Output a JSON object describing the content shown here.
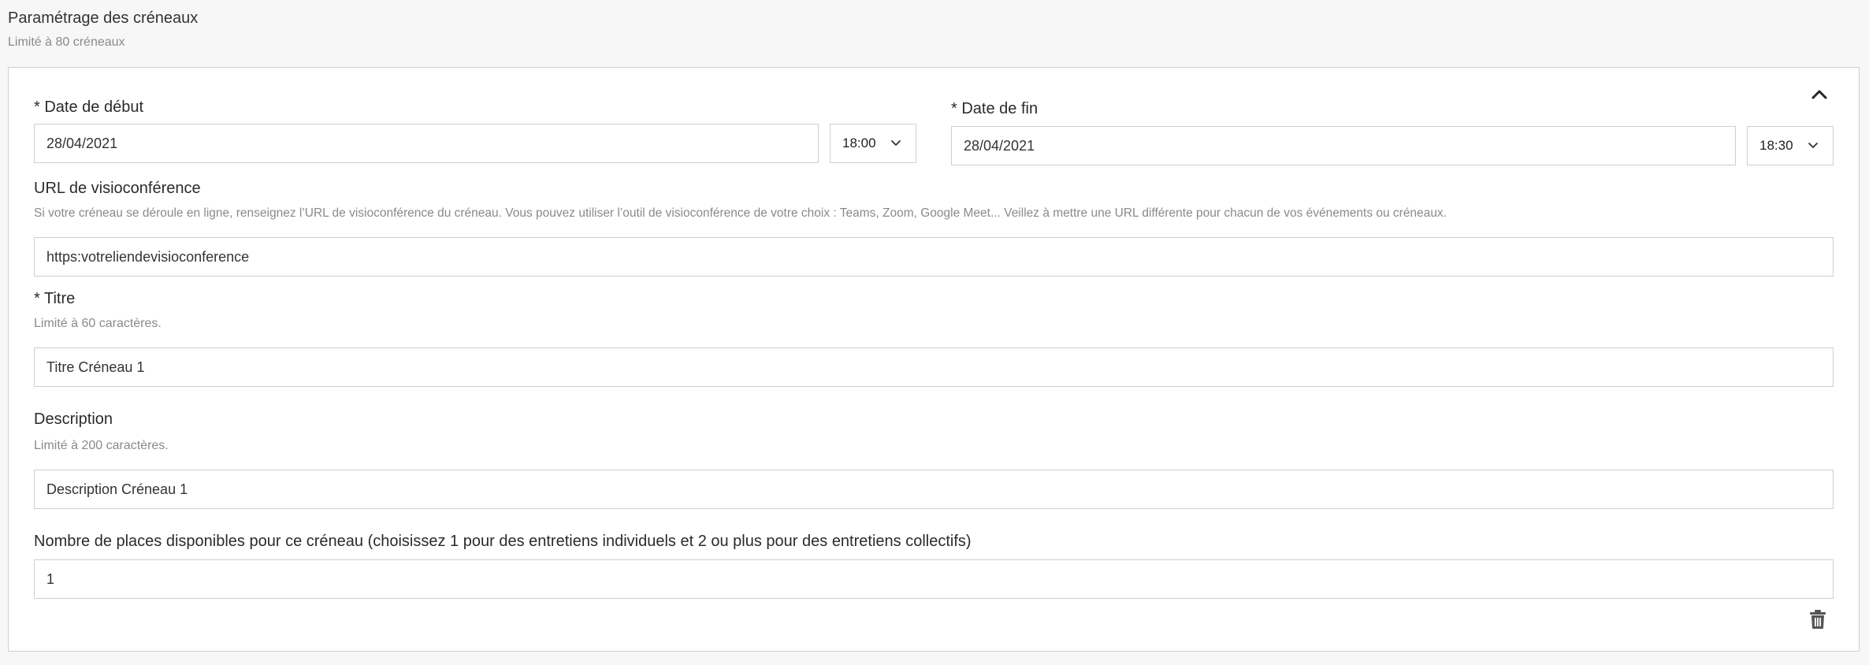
{
  "section": {
    "title": "Paramétrage des créneaux",
    "subtitle": "Limité à 80 créneaux"
  },
  "slot": {
    "start_date": {
      "label": "* Date de début",
      "value": "28/04/2021",
      "time": "18:00"
    },
    "end_date": {
      "label": "* Date de fin",
      "value": "28/04/2021",
      "time": "18:30"
    },
    "video_url": {
      "label": "URL de visioconférence",
      "help": "Si votre créneau se déroule en ligne, renseignez l’URL de visioconférence du créneau. Vous pouvez utiliser l’outil de visioconférence de votre choix : Teams, Zoom, Google Meet... Veillez à mettre une URL différente pour chacun de vos événements ou créneaux.",
      "value": "https:votreliendevisioconference"
    },
    "title": {
      "label": "* Titre",
      "help": "Limité à 60 caractères.",
      "value": "Titre Créneau 1"
    },
    "description": {
      "label": "Description",
      "help": "Limité à 200 caractères.",
      "value": "Description Créneau 1"
    },
    "seats": {
      "label": "Nombre de places disponibles pour ce créneau (choisissez 1 pour des entretiens individuels et 2 ou plus pour des entretiens collectifs)",
      "value": "1"
    }
  },
  "icons": {
    "collapse": "chevron-up-icon",
    "delete": "trash-icon",
    "dropdown": "chevron-down-icon"
  }
}
